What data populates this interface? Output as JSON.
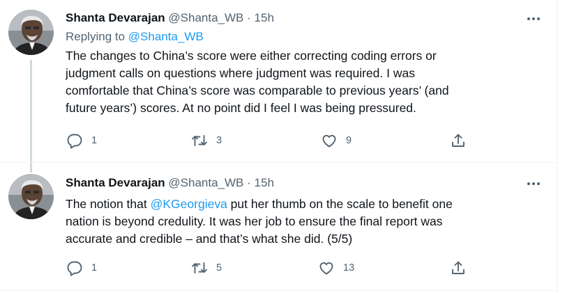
{
  "tweets": [
    {
      "name": "Shanta Devarajan",
      "handle": "@Shanta_WB",
      "dot": "·",
      "time": "15h",
      "replying_label": "Replying to",
      "replying_handle": "@Shanta_WB",
      "text_lines": [
        "The changes to China’s score were either correcting coding errors or",
        "judgment calls on questions where judgment was required.  I was",
        "comfortable that China’s score was comparable to previous years’ (and",
        "future years’) scores.  At no point did I feel I was being pressured."
      ],
      "replies": "1",
      "retweets": "3",
      "likes": "9"
    },
    {
      "name": "Shanta Devarajan",
      "handle": "@Shanta_WB",
      "dot": "·",
      "time": "15h",
      "text_prefix": "The notion that ",
      "mention": "@KGeorgieva",
      "text_suffix": " put her thumb on the scale to benefit one",
      "text_lines": [
        "nation is beyond credulity. It was her job to ensure the final report was",
        "accurate and credible – and that’s what she did. (5/5)"
      ],
      "replies": "1",
      "retweets": "5",
      "likes": "13"
    }
  ],
  "icons": [
    "avatar",
    "more-icon",
    "reply-icon",
    "retweet-icon",
    "like-icon",
    "share-icon"
  ],
  "colors": {
    "link": "#1d9bf0",
    "secondary": "#536471",
    "text": "#0f1419",
    "divider": "#eff3f4",
    "thread_line": "#cfd9de"
  }
}
